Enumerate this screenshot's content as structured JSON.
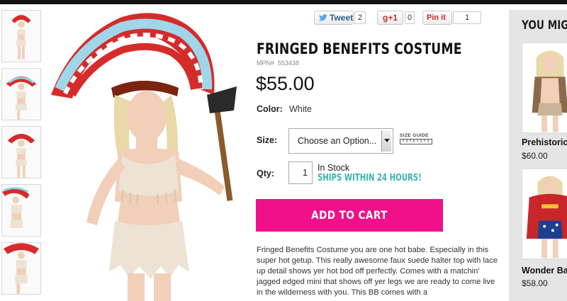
{
  "social": {
    "tweet_label": "Tweet",
    "tweet_count": "2",
    "gplus_label": "+1",
    "gplus_prefix": "g",
    "gplus_count": "0",
    "pinit_label": "Pin it",
    "pinit_count": "1"
  },
  "product": {
    "title": "FRINGED BENEFITS COSTUME",
    "mpn_label": "MPN#",
    "mpn_value": "553438",
    "price": "$55.00",
    "color_label": "Color:",
    "color_value": "White",
    "size_label": "Size:",
    "size_placeholder": "Choose an Option...",
    "size_guide_label": "SIZE GUIDE",
    "qty_label": "Qty:",
    "qty_value": "1",
    "stock_status": "In Stock",
    "ships_note": "SHIPS WITHIN 24 HOURS!",
    "add_to_cart_label": "ADD TO CART",
    "description": "Fringed Benefits Costume you are one hot babe. Especially in this super hot getup. This really awesome faux suede halter top with lace up detail shows yer hot bod off perfectly. Comes with a matchin' jagged edged mini that shows off yer legs we are ready to come live in the wilderness with you. This BB comes with a"
  },
  "sidebar": {
    "title": "YOU MIGHT",
    "items": [
      {
        "name": "Prehistoric",
        "price": "$60.00"
      },
      {
        "name": "Wonder Ba",
        "price": "$58.00"
      }
    ]
  },
  "colors": {
    "accent_pink": "#f0108a",
    "ships_teal": "#36b6ad",
    "topbar": "#111111"
  }
}
